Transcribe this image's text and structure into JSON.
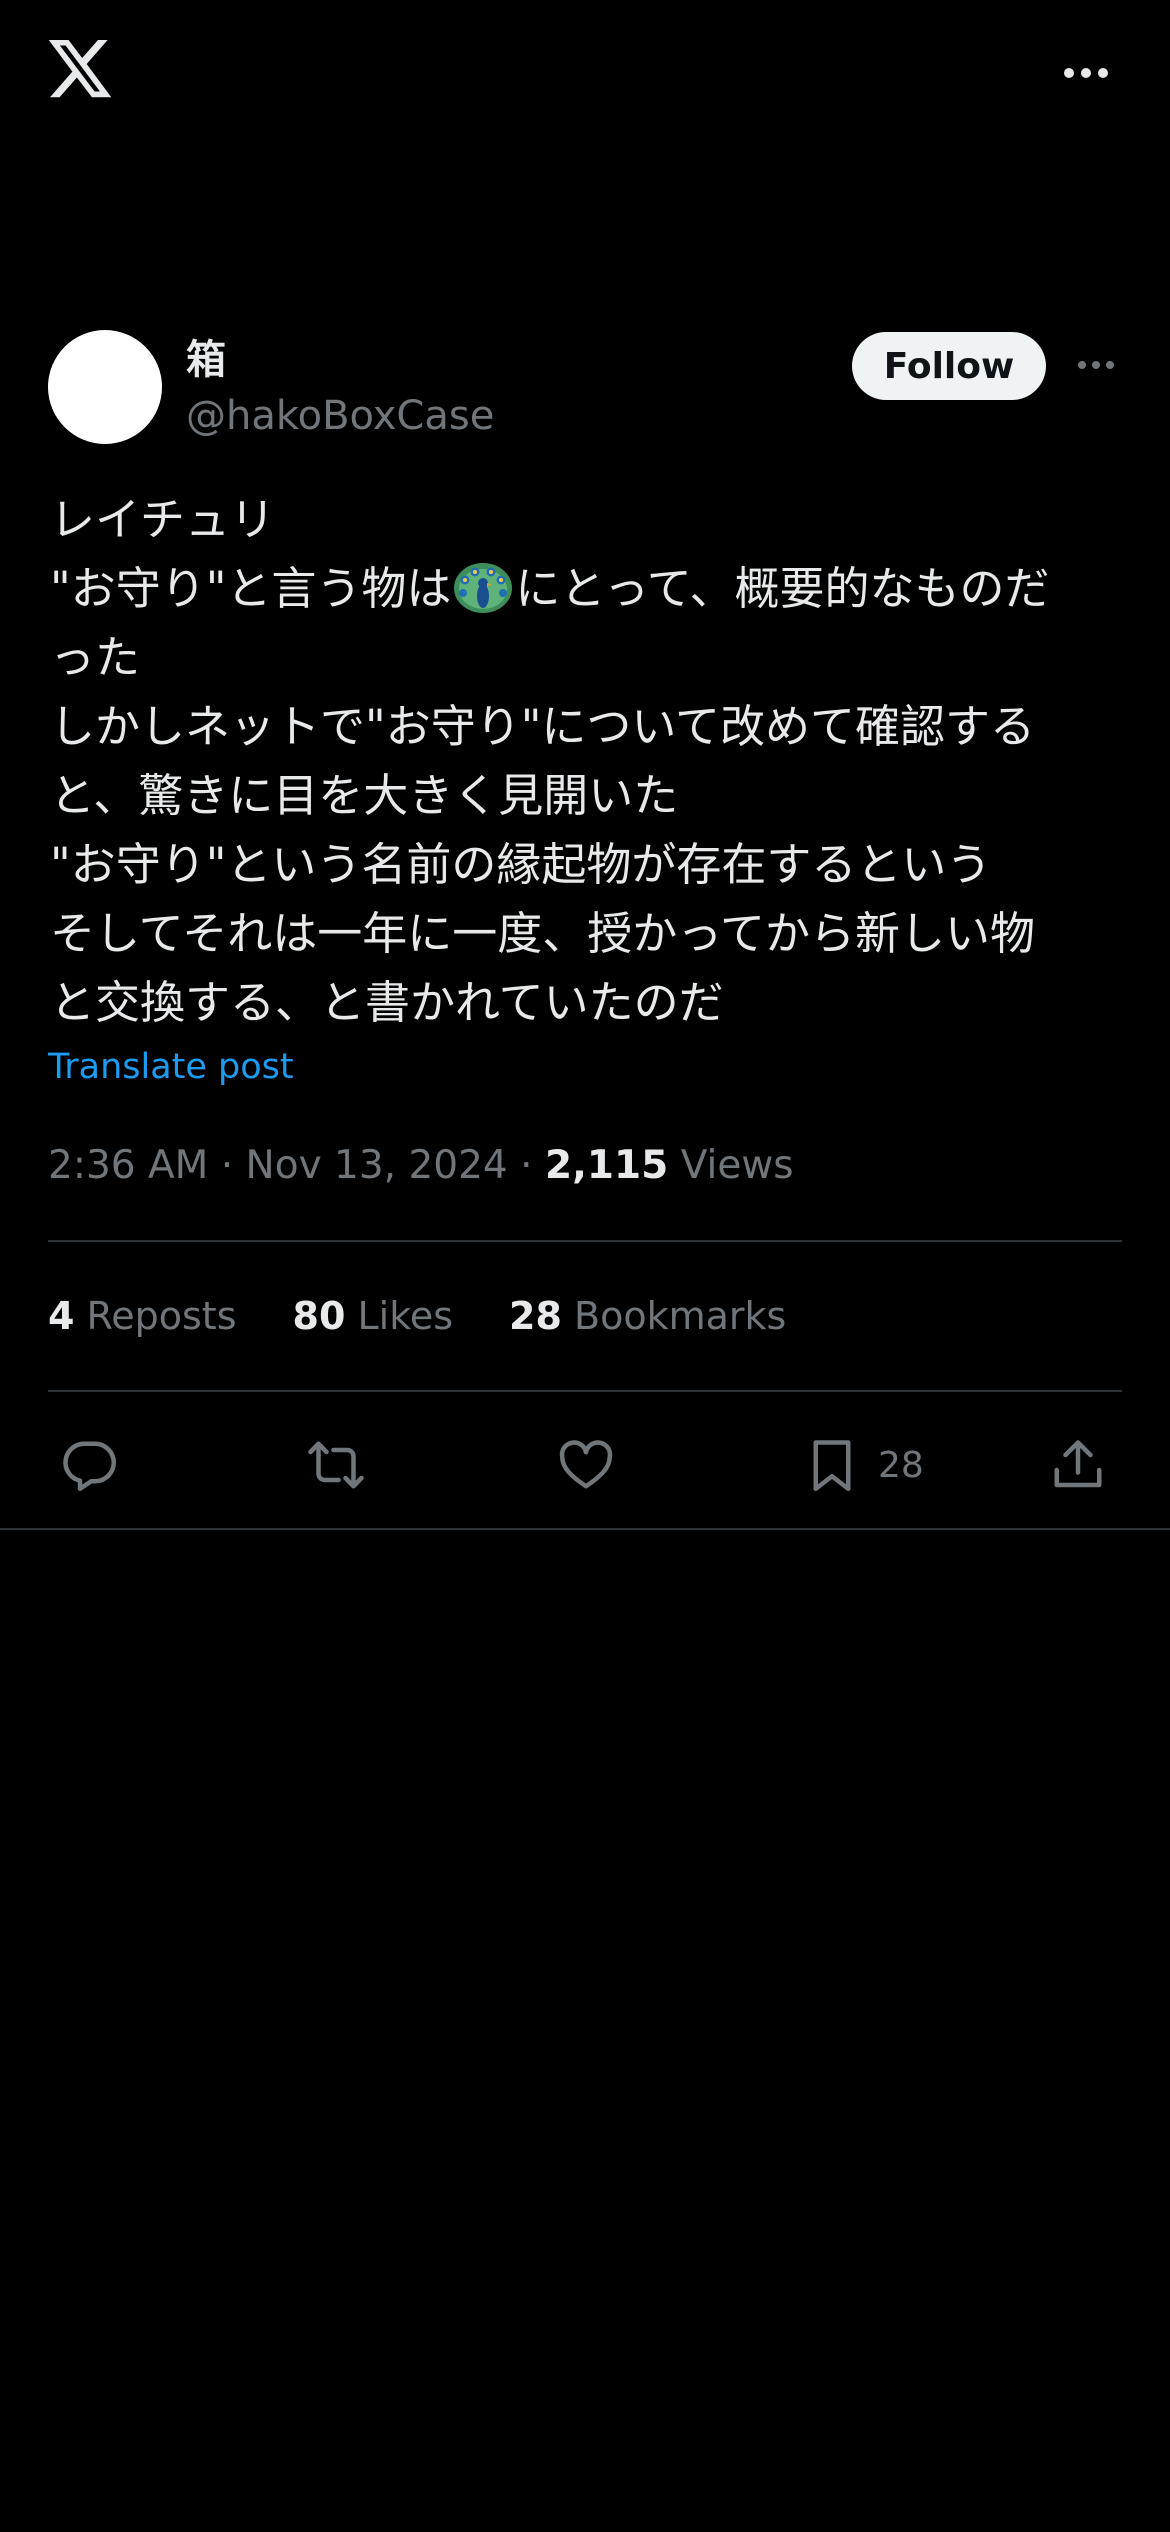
{
  "topbar": {
    "logo_icon": "x-logo-icon",
    "more_icon": "more-horizontal-icon"
  },
  "author": {
    "display_name": "箱",
    "handle": "@hakoBoxCase",
    "follow_label": "Follow",
    "avatar_color": "#ffffff"
  },
  "tweet": {
    "lines": [
      "レイチュリ",
      "\"お守り\"と言う物は",
      "にとって、概要的なものだ",
      "った",
      "しかしネットで\"お守り\"について改めて確認する",
      "と、驚きに目を大きく見開いた",
      "\"お守り\"という名前の縁起物が存在するという",
      "そしてそれは一年に一度、授かってから新しい物",
      "と交換する、と書かれていたのだ"
    ],
    "emoji": "peacock-emoji",
    "translate_label": "Translate post"
  },
  "meta": {
    "time": "2:36 AM",
    "separator": "·",
    "date": "Nov 13, 2024",
    "views_count": "2,115",
    "views_label": "Views"
  },
  "stats": {
    "reposts_count": "4",
    "reposts_label": "Reposts",
    "likes_count": "80",
    "likes_label": "Likes",
    "bookmarks_count": "28",
    "bookmarks_label": "Bookmarks"
  },
  "actions": {
    "reply_icon": "reply-icon",
    "repost_icon": "repost-icon",
    "like_icon": "heart-icon",
    "bookmark_icon": "bookmark-icon",
    "bookmark_count": "28",
    "share_icon": "share-icon"
  },
  "colors": {
    "background": "#000000",
    "text": "#e7e9ea",
    "secondary": "#71767b",
    "link": "#1d9bf0",
    "divider": "#2f3336",
    "follow_bg": "#eff3f4"
  }
}
